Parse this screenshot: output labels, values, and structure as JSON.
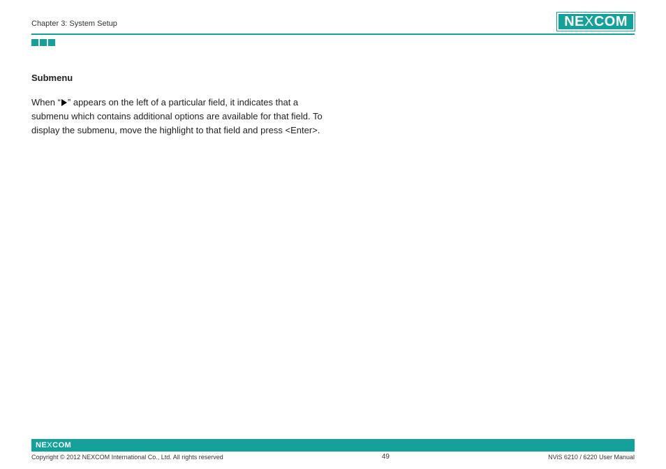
{
  "header": {
    "chapter": "Chapter 3: System Setup",
    "logo_main": "NE",
    "logo_mid": "X",
    "logo_end": "COM"
  },
  "content": {
    "heading": "Submenu",
    "para_pre": "When “",
    "para_post": "” appears on the left of a particular field, it indicates that a submenu which contains additional options are available for that field. To display the submenu, move the highlight to that field and press <Enter>."
  },
  "footer": {
    "logo_main": "NE",
    "logo_mid": "X",
    "logo_end": "COM",
    "copyright": "Copyright © 2012 NEXCOM International Co., Ltd. All rights reserved",
    "page_number": "49",
    "doc_title": "NViS 6210 / 6220 User Manual"
  }
}
